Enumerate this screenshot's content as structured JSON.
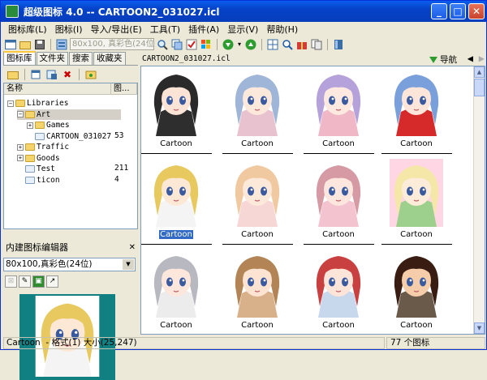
{
  "window": {
    "title": "超级图标 4.0 -- CARTOON2_031027.icl",
    "min": "_",
    "max": "□",
    "close": "✕"
  },
  "menu": [
    "图标库(L)",
    "图标(I)",
    "导入/导出(E)",
    "工具(T)",
    "插件(A)",
    "显示(V)",
    "帮助(H)"
  ],
  "toolbar": {
    "size_combo": "80x100, 真彩色(24位"
  },
  "tabs": [
    "图标库",
    "文件夹",
    "搜索",
    "收藏夹"
  ],
  "tree": {
    "headers": [
      "名称",
      "图..."
    ],
    "rows": [
      {
        "label": "Libraries",
        "count": "",
        "level": 0
      },
      {
        "label": "Art",
        "count": "",
        "level": 1
      },
      {
        "label": "Games",
        "count": "",
        "level": 2
      },
      {
        "label": "CARTOON_031027",
        "count": "53",
        "level": 2
      },
      {
        "label": "Traffic",
        "count": "",
        "level": 1
      },
      {
        "label": "Goods",
        "count": "",
        "level": 1
      },
      {
        "label": "Test",
        "count": "211",
        "level": 1
      },
      {
        "label": "ticon",
        "count": "4",
        "level": 1
      }
    ]
  },
  "editor": {
    "title": "内建图标编辑器",
    "close": "✕",
    "format": "80x100,真彩色(24位)"
  },
  "right": {
    "filename": "CARTOON2_031027.icl",
    "nav_label": "导航"
  },
  "icons": [
    {
      "caption": "Cartoon",
      "hair": "#2a2a2a",
      "bg": "#ffffff",
      "skin": "#fbe4d6",
      "shirt": "#2e2e2e"
    },
    {
      "caption": "Cartoon",
      "hair": "#9fb6d8",
      "bg": "#ffffff",
      "skin": "#fde8dc",
      "shirt": "#e8c2cf"
    },
    {
      "caption": "Cartoon",
      "hair": "#b5a2db",
      "bg": "#ffffff",
      "skin": "#fde9df",
      "shirt": "#f0b7c6"
    },
    {
      "caption": "Cartoon",
      "hair": "#7aa0dc",
      "bg": "#ffffff",
      "skin": "#fde6d9",
      "shirt": "#d62a2a"
    },
    {
      "caption": "Cartoon",
      "hair": "#e7c960",
      "bg": "#ffffff",
      "skin": "#fde8d6",
      "shirt": "#f4f4f4",
      "selected": true
    },
    {
      "caption": "Cartoon",
      "hair": "#f0c9a0",
      "bg": "#ffffff",
      "skin": "#fde9da",
      "shirt": "#f7d6d6"
    },
    {
      "caption": "Cartoon",
      "hair": "#d69aa4",
      "bg": "#ffffff",
      "skin": "#fde6de",
      "shirt": "#f3c3cf"
    },
    {
      "caption": "Cartoon",
      "hair": "#f4e7a8",
      "bg": "#ffd6e4",
      "skin": "#fdecd9",
      "shirt": "#9dd08c"
    },
    {
      "caption": "Cartoon",
      "hair": "#b8b8c0",
      "bg": "#ffffff",
      "skin": "#fde6dc",
      "shirt": "#ececec"
    },
    {
      "caption": "Cartoon",
      "hair": "#b38556",
      "bg": "#ffffff",
      "skin": "#fde4d2",
      "shirt": "#d8b08a"
    },
    {
      "caption": "Cartoon",
      "hair": "#c94040",
      "bg": "#ffffff",
      "skin": "#fde4d8",
      "shirt": "#c7d7ec"
    },
    {
      "caption": "Cartoon",
      "hair": "#3a1d12",
      "bg": "#ffffff",
      "skin": "#f5cdaa",
      "shirt": "#6a5a4a"
    }
  ],
  "status": {
    "left": "Cartoon  - 格式(1) 大小(25,247)",
    "right": "77 个图标"
  },
  "colors": {
    "titlebar": "#0542c7",
    "preview_bg": "#118083",
    "selection": "#316ac5"
  }
}
